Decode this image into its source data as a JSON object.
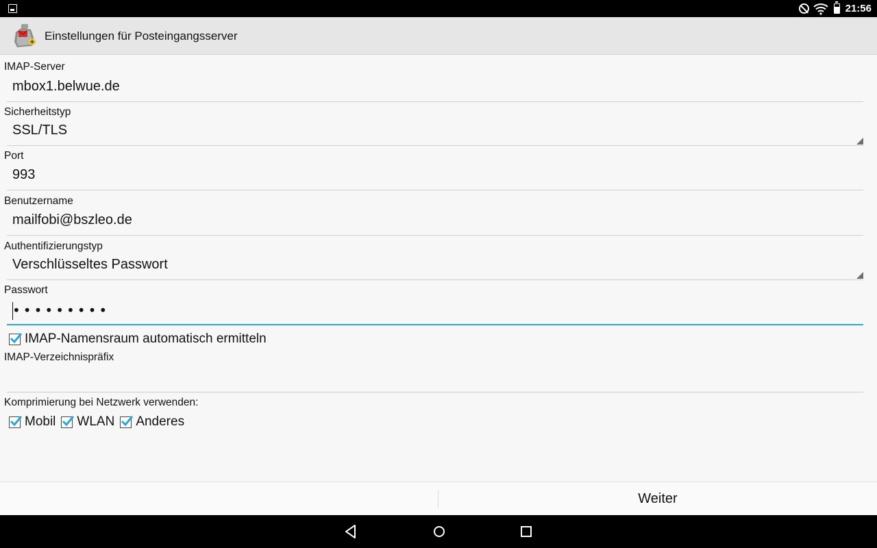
{
  "statusbar": {
    "time": "21:56",
    "icons": [
      "image-icon",
      "do-not-disturb-icon",
      "wifi-icon",
      "battery-icon"
    ]
  },
  "actionbar": {
    "title": "Einstellungen für Posteingangsserver",
    "logo": "k9-mail-logo"
  },
  "form": {
    "imap_server": {
      "label": "IMAP-Server",
      "value": "mbox1.belwue.de"
    },
    "security": {
      "label": "Sicherheitstyp",
      "value": "SSL/TLS"
    },
    "port": {
      "label": "Port",
      "value": "993"
    },
    "username": {
      "label": "Benutzername",
      "value": "mailfobi@bszleo.de"
    },
    "auth": {
      "label": "Authentifizierungstyp",
      "value": "Verschlüsseltes Passwort"
    },
    "password": {
      "label": "Passwort",
      "masked": "•••••••••"
    },
    "auto_namespace": {
      "label": "IMAP-Namensraum automatisch ermitteln",
      "checked": true
    },
    "prefix": {
      "label": "IMAP-Verzeichnispräfix",
      "value": ""
    },
    "compression": {
      "label": "Komprimierung bei Netzwerk verwenden:",
      "options": [
        {
          "label": "Mobil",
          "checked": true
        },
        {
          "label": "WLAN",
          "checked": true
        },
        {
          "label": "Anderes",
          "checked": true
        }
      ]
    }
  },
  "buttons": {
    "next": "Weiter"
  },
  "colors": {
    "accent": "#2ba7d3",
    "check": "#2ba7d3",
    "actionbar": "#e6e6e6"
  }
}
